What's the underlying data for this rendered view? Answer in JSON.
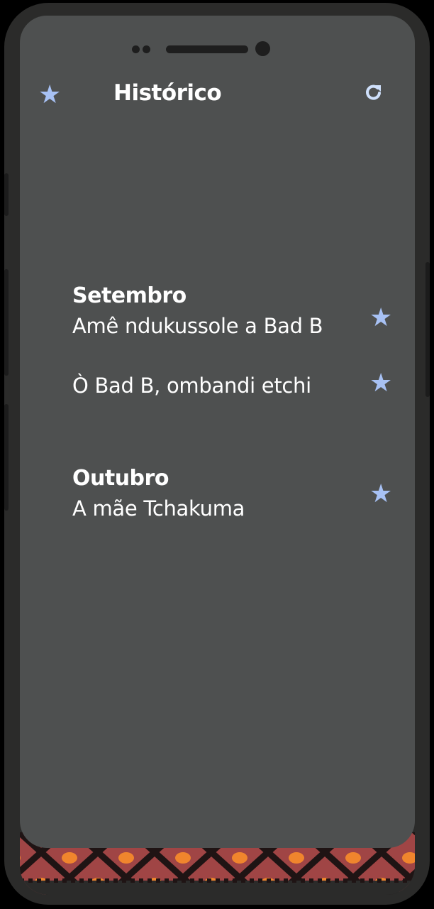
{
  "header": {
    "title": "Histórico",
    "favorites_icon": "star-icon",
    "refresh_icon": "refresh-icon"
  },
  "history": [
    {
      "month": "Setembro",
      "entries": [
        {
          "title": "Amê ndukussole a Bad B",
          "favorite_icon": "star-icon"
        },
        {
          "title": "Ò Bad B, ombandi etchi",
          "favorite_icon": "star-icon"
        }
      ]
    },
    {
      "month": "Outubro",
      "entries": [
        {
          "title": "A mãe Tchakuma",
          "favorite_icon": "star-icon"
        }
      ]
    }
  ],
  "colors": {
    "screen_background": "#4e5050",
    "accent_star": "#a7c1f4",
    "text": "#ffffff",
    "device_frame": "#2b2b2a",
    "pattern_red": "#a04545",
    "pattern_orange": "#f0852d"
  }
}
